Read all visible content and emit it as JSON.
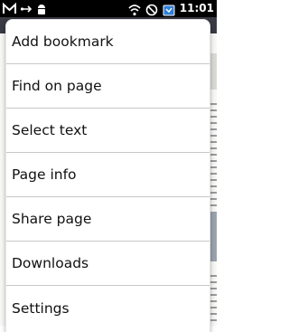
{
  "status_bar": {
    "time": "11:01",
    "icons_left": [
      "gmail-icon",
      "usb-debug-icon",
      "android-icon"
    ],
    "icons_right": [
      "wifi-icon",
      "signal-blocked-icon",
      "battery-icon"
    ]
  },
  "menu": {
    "items": [
      {
        "label": "Add bookmark"
      },
      {
        "label": "Find on page"
      },
      {
        "label": "Select text"
      },
      {
        "label": "Page info"
      },
      {
        "label": "Share page"
      },
      {
        "label": "Downloads"
      },
      {
        "label": "Settings"
      }
    ]
  }
}
